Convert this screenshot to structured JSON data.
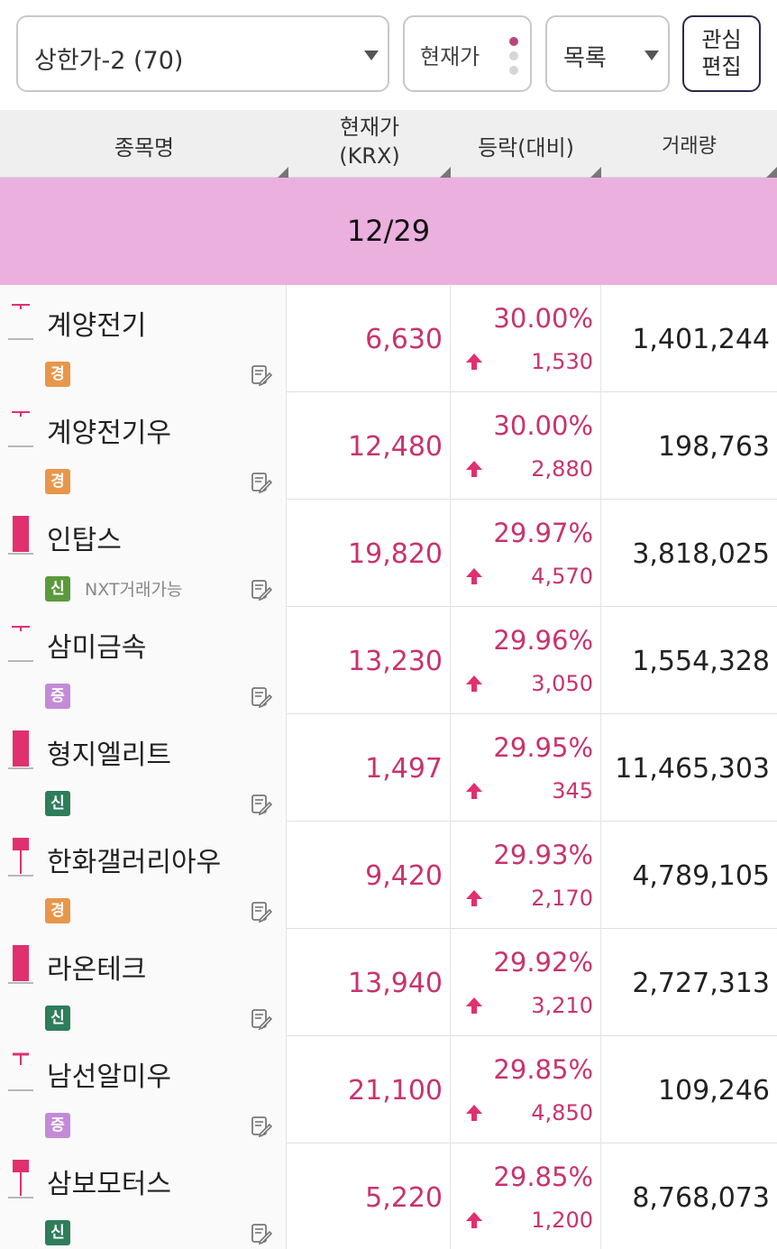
{
  "toolbar": {
    "condition_select": "상한가-2 (70)",
    "price_button": "현재가",
    "list_select": "목록",
    "edit_line1": "관심",
    "edit_line2": "편집"
  },
  "header": {
    "name": "종목명",
    "price_line1": "현재가",
    "price_line2": "(KRX)",
    "rate": "등락(대비)",
    "volume": "거래량"
  },
  "date_band": "12/29",
  "colors": {
    "up": "#c8336f",
    "candle": "#e0306f",
    "band": "#ecb0df"
  },
  "rows": [
    {
      "name": "계양전기",
      "badge": "경",
      "badge_color": "#e8964a",
      "nxt": "",
      "price": "6,630",
      "rate": "30.00%",
      "diff": "1,530",
      "volume": "1,401,244",
      "candle": "dash"
    },
    {
      "name": "계양전기우",
      "badge": "경",
      "badge_color": "#e8964a",
      "nxt": "",
      "price": "12,480",
      "rate": "30.00%",
      "diff": "2,880",
      "volume": "198,763",
      "candle": "dash"
    },
    {
      "name": "인탑스",
      "badge": "신",
      "badge_color": "#5a9a3c",
      "nxt": "NXT거래가능",
      "price": "19,820",
      "rate": "29.97%",
      "diff": "4,570",
      "volume": "3,818,025",
      "candle": "full"
    },
    {
      "name": "삼미금속",
      "badge": "증",
      "badge_color": "#c48ad8",
      "nxt": "",
      "price": "13,230",
      "rate": "29.96%",
      "diff": "3,050",
      "volume": "1,554,328",
      "candle": "dash"
    },
    {
      "name": "형지엘리트",
      "badge": "신",
      "badge_color": "#2e7d5b",
      "nxt": "",
      "price": "1,497",
      "rate": "29.95%",
      "diff": "345",
      "volume": "11,465,303",
      "candle": "full"
    },
    {
      "name": "한화갤러리아우",
      "badge": "경",
      "badge_color": "#e8964a",
      "nxt": "",
      "price": "9,420",
      "rate": "29.93%",
      "diff": "2,170",
      "volume": "4,789,105",
      "candle": "hammer"
    },
    {
      "name": "라온테크",
      "badge": "신",
      "badge_color": "#2e7d5b",
      "nxt": "",
      "price": "13,940",
      "rate": "29.92%",
      "diff": "3,210",
      "volume": "2,727,313",
      "candle": "full"
    },
    {
      "name": "남선알미우",
      "badge": "증",
      "badge_color": "#c48ad8",
      "nxt": "",
      "price": "21,100",
      "rate": "29.85%",
      "diff": "4,850",
      "volume": "109,246",
      "candle": "tee"
    },
    {
      "name": "삼보모터스",
      "badge": "신",
      "badge_color": "#2e7d5b",
      "nxt": "",
      "price": "5,220",
      "rate": "29.85%",
      "diff": "1,200",
      "volume": "8,768,073",
      "candle": "hammer"
    }
  ]
}
